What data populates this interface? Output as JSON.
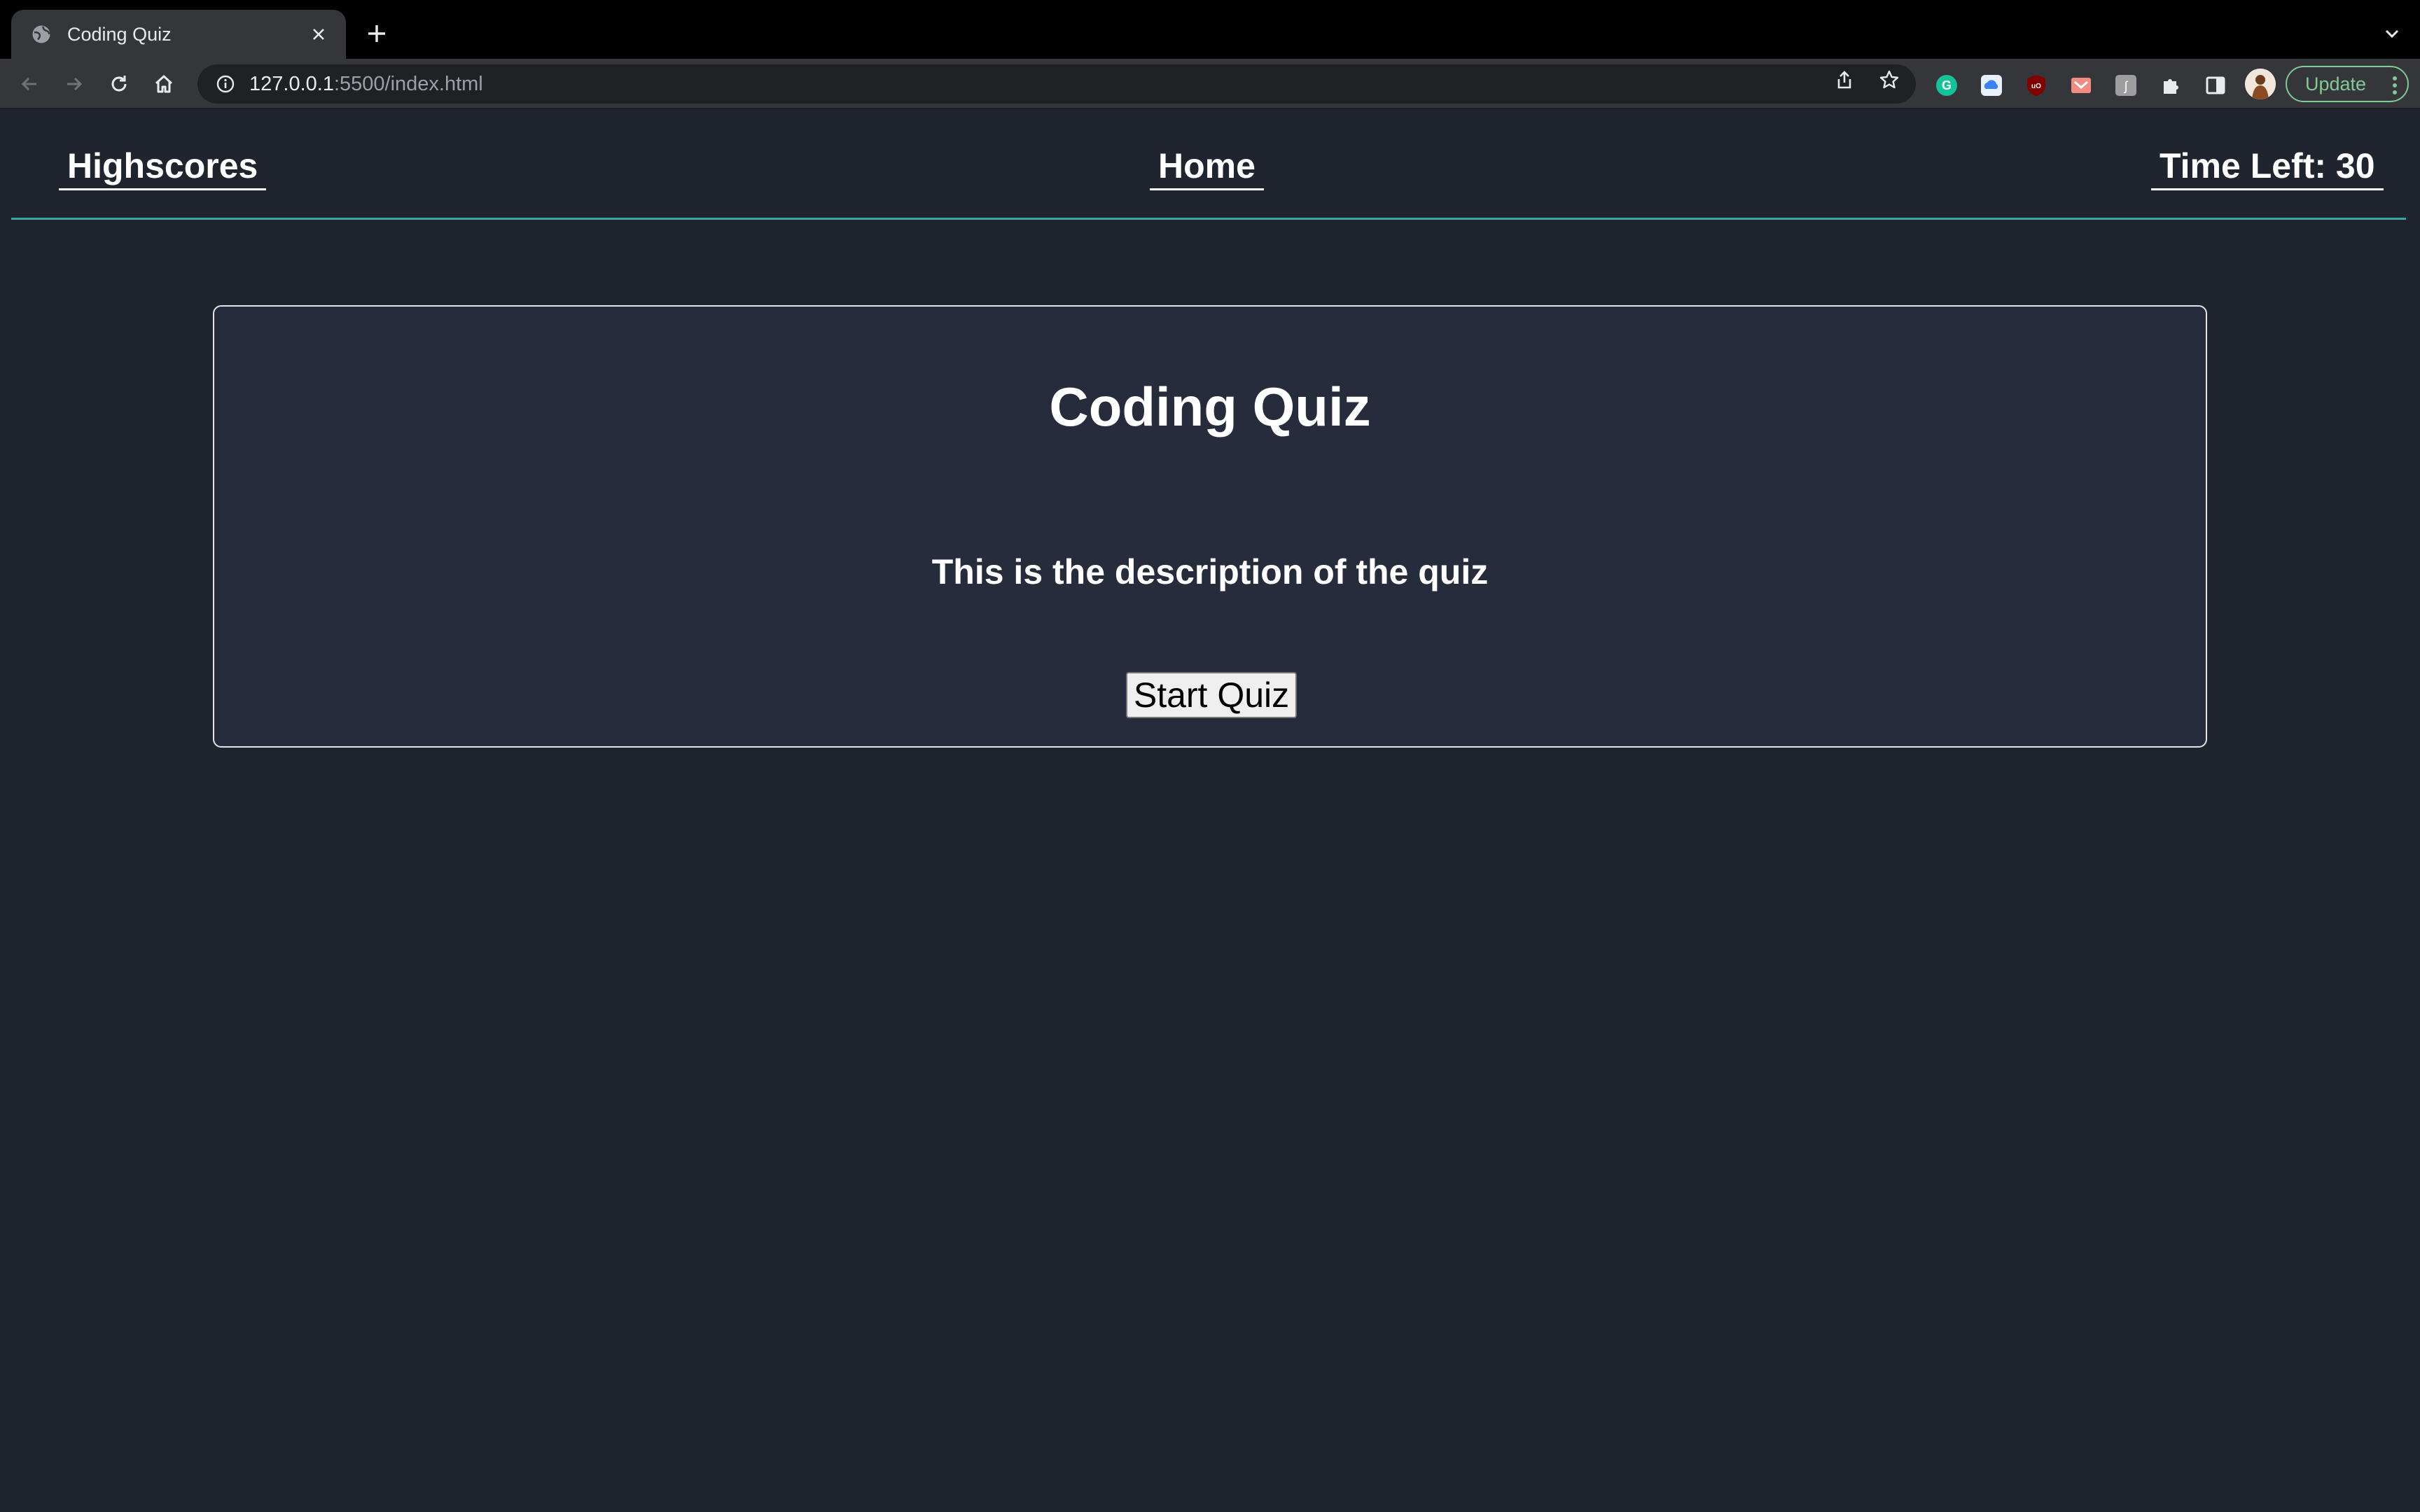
{
  "browser": {
    "tab_title": "Coding Quiz",
    "url_host": "127.0.0.1",
    "url_rest": ":5500/index.html",
    "update_label": "Update",
    "accent_update": "#81c995"
  },
  "site": {
    "nav_highscores": "Highscores",
    "nav_home": "Home",
    "timer_label": "Time Left: 30",
    "header_border_color": "#3aa6a0",
    "background": "#20242e"
  },
  "quiz": {
    "title": "Coding Quiz",
    "description": "This is the description of the quiz",
    "start_label": "Start Quiz"
  },
  "icons": {
    "tab_favicon": "globe-icon",
    "tab_close": "close-icon",
    "new_tab": "plus-icon",
    "tab_search": "chevron-down-icon",
    "back": "arrow-left-icon",
    "forward": "arrow-right-icon",
    "reload": "reload-icon",
    "home": "home-icon",
    "site_info": "info-icon",
    "share": "share-icon",
    "bookmark": "star-icon",
    "extensions": [
      "grammarly-icon",
      "cloud-icon",
      "ublock-icon",
      "extension-icon",
      "translate-icon",
      "puzzle-icon"
    ],
    "side_panel": "side-panel-icon",
    "menu": "kebab-menu-icon"
  }
}
